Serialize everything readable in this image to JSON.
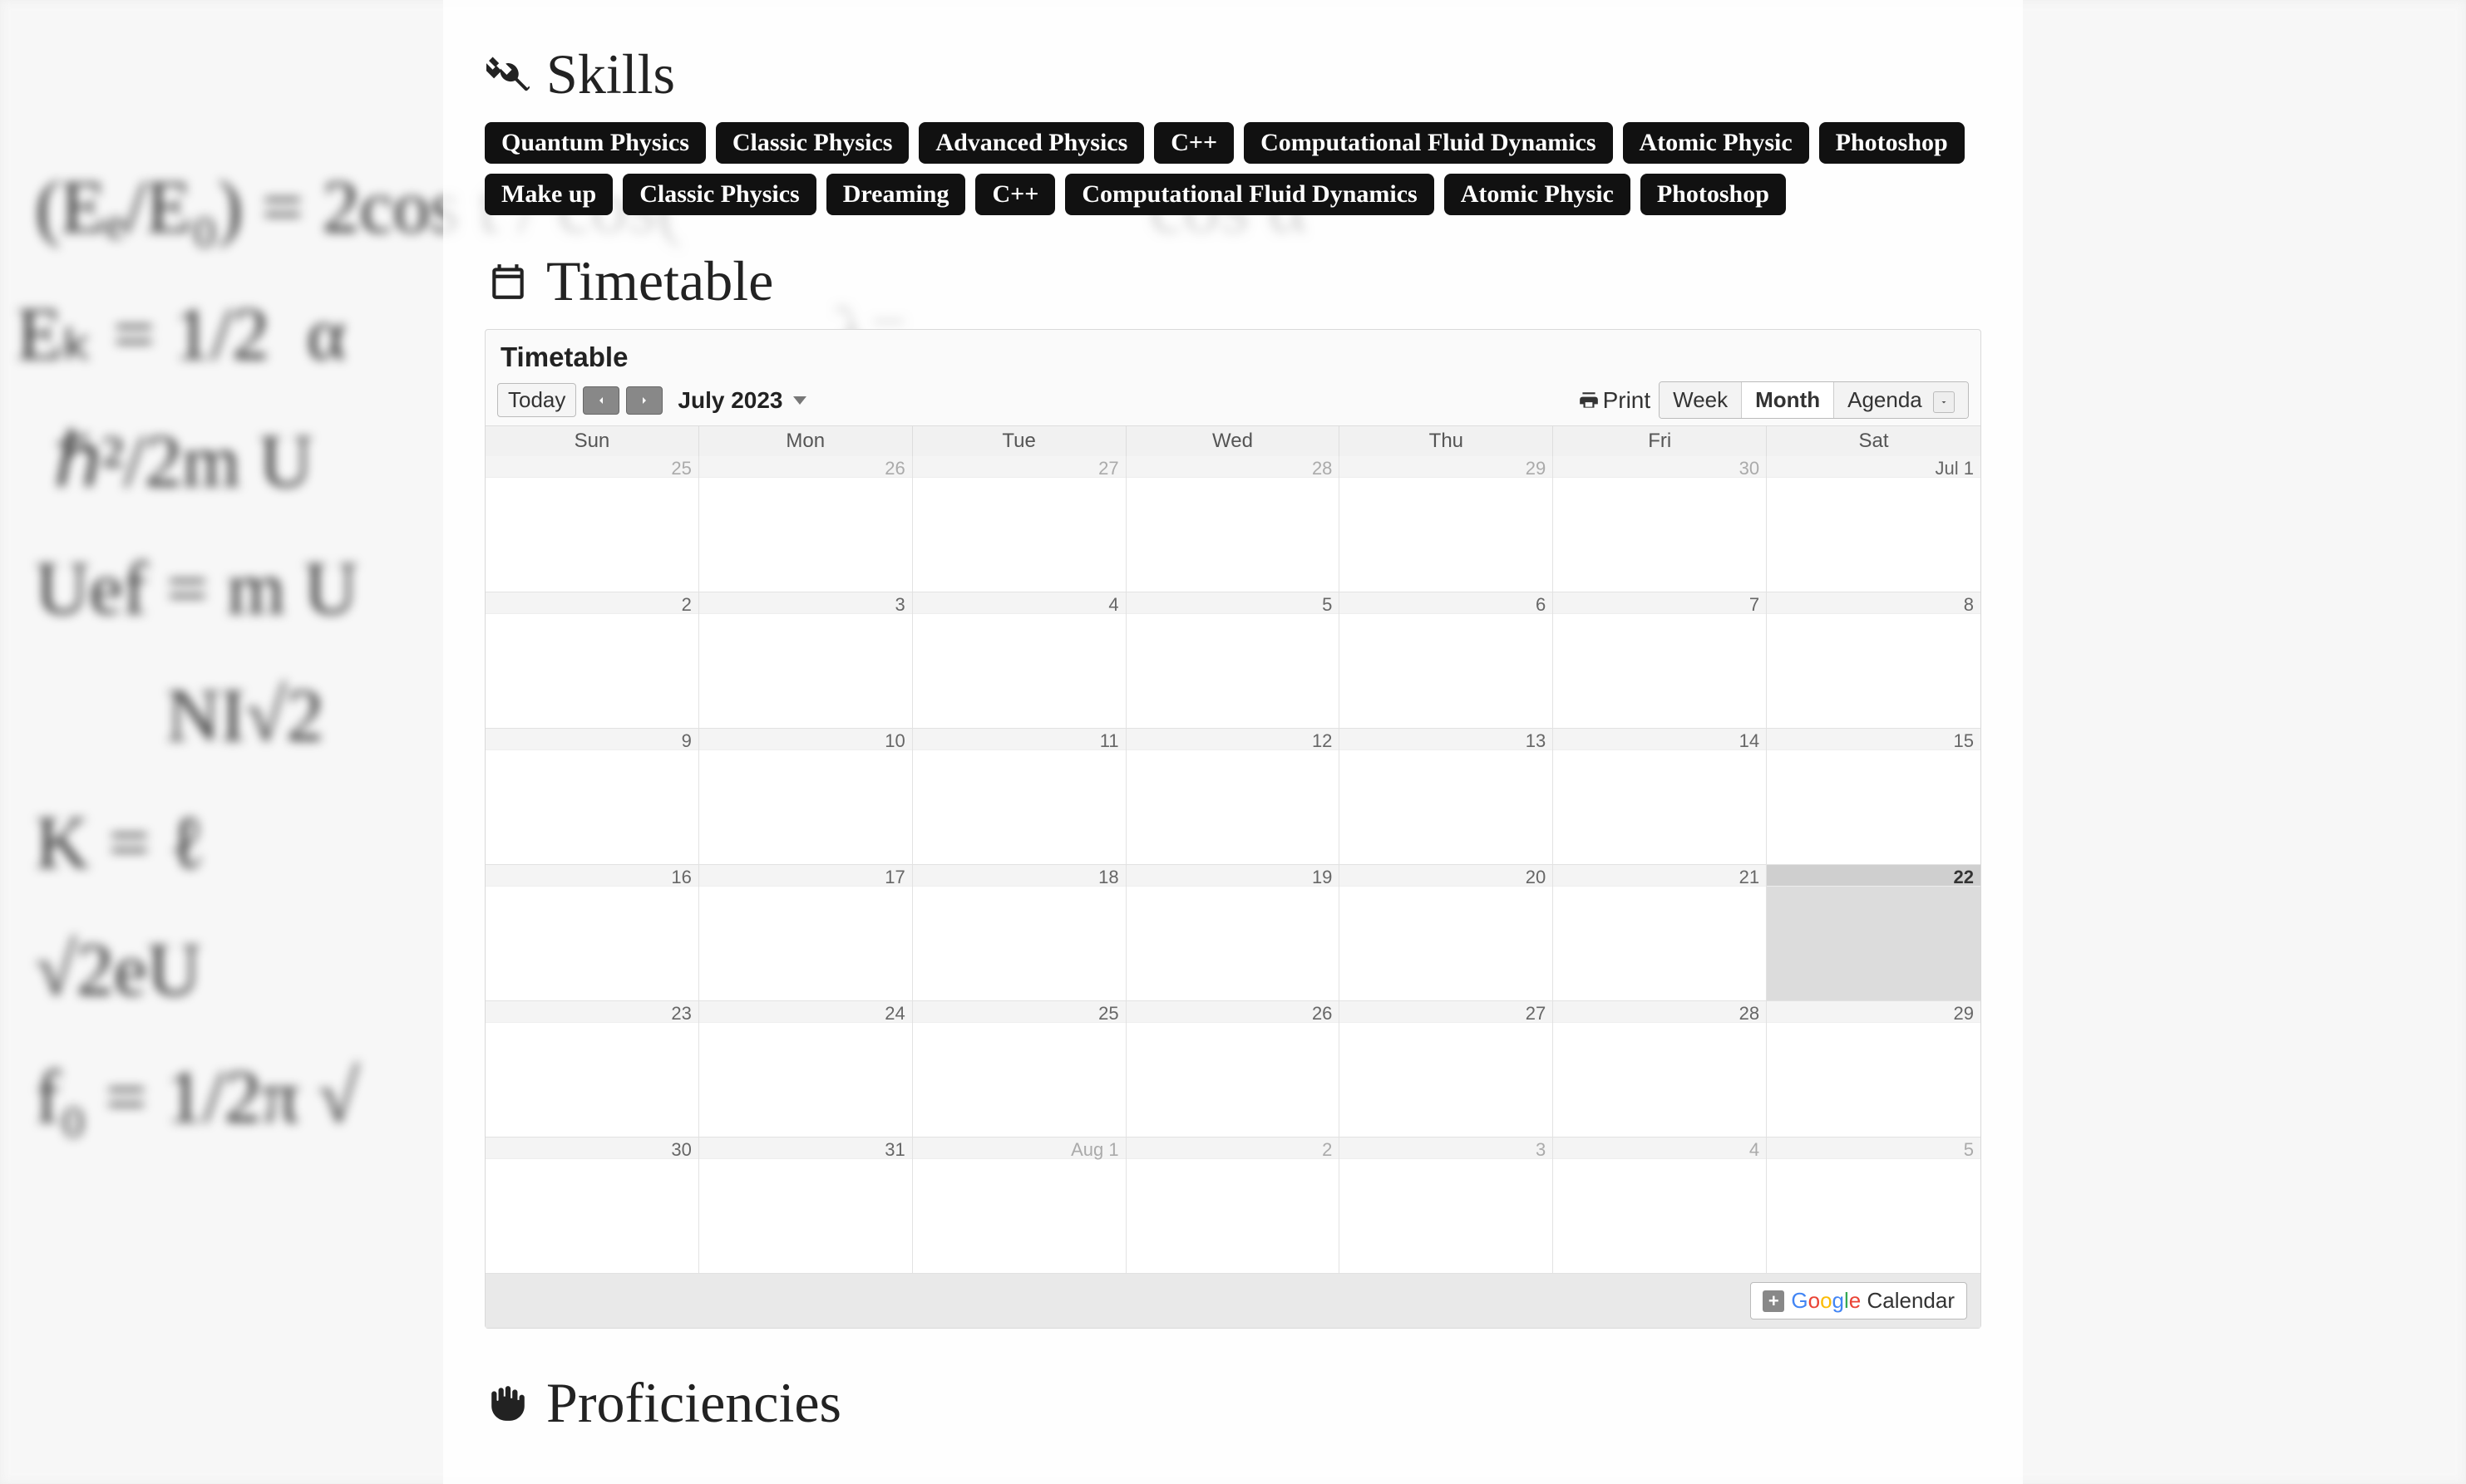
{
  "sections": {
    "skills_title": "Skills",
    "timetable_title": "Timetable",
    "proficiencies_title": "Proficiencies"
  },
  "skills": [
    "Quantum Physics",
    "Classic Physics",
    "Advanced Physics",
    "C++",
    "Computational Fluid Dynamics",
    "Atomic Physic",
    "Photoshop",
    "Make up",
    "Classic Physics",
    "Dreaming",
    "C++",
    "Computational Fluid Dynamics",
    "Atomic Physic",
    "Photoshop"
  ],
  "calendar": {
    "widget_title": "Timetable",
    "today_label": "Today",
    "month_label": "July 2023",
    "print_label": "Print",
    "views": {
      "week": "Week",
      "month": "Month",
      "agenda": "Agenda",
      "active": "month"
    },
    "day_headers": [
      "Sun",
      "Mon",
      "Tue",
      "Wed",
      "Thu",
      "Fri",
      "Sat"
    ],
    "today_cell": "22",
    "weeks": [
      [
        {
          "label": "25",
          "other": true
        },
        {
          "label": "26",
          "other": true
        },
        {
          "label": "27",
          "other": true
        },
        {
          "label": "28",
          "other": true
        },
        {
          "label": "29",
          "other": true
        },
        {
          "label": "30",
          "other": true
        },
        {
          "label": "Jul 1",
          "other": false
        }
      ],
      [
        {
          "label": "2"
        },
        {
          "label": "3"
        },
        {
          "label": "4"
        },
        {
          "label": "5"
        },
        {
          "label": "6"
        },
        {
          "label": "7"
        },
        {
          "label": "8"
        }
      ],
      [
        {
          "label": "9"
        },
        {
          "label": "10"
        },
        {
          "label": "11"
        },
        {
          "label": "12"
        },
        {
          "label": "13"
        },
        {
          "label": "14"
        },
        {
          "label": "15"
        }
      ],
      [
        {
          "label": "16"
        },
        {
          "label": "17"
        },
        {
          "label": "18"
        },
        {
          "label": "19"
        },
        {
          "label": "20"
        },
        {
          "label": "21"
        },
        {
          "label": "22"
        }
      ],
      [
        {
          "label": "23"
        },
        {
          "label": "24"
        },
        {
          "label": "25"
        },
        {
          "label": "26"
        },
        {
          "label": "27"
        },
        {
          "label": "28"
        },
        {
          "label": "29"
        }
      ],
      [
        {
          "label": "30"
        },
        {
          "label": "31"
        },
        {
          "label": "Aug 1",
          "other": true
        },
        {
          "label": "2",
          "other": true
        },
        {
          "label": "3",
          "other": true
        },
        {
          "label": "4",
          "other": true
        },
        {
          "label": "5",
          "other": true
        }
      ]
    ],
    "footer_brand_calendar": "Calendar"
  }
}
